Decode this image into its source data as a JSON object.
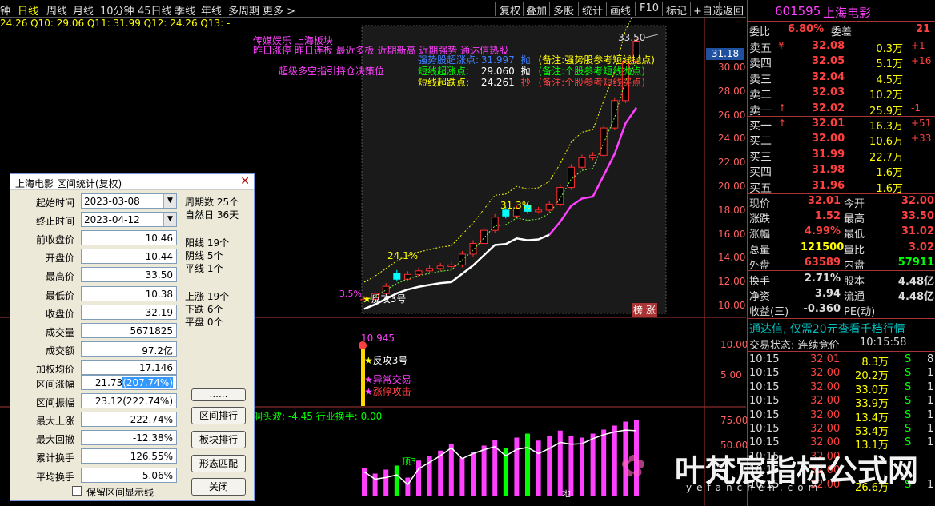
{
  "topbar": {
    "items": [
      "钟",
      "日线",
      "周线",
      "月线",
      "10分钟",
      "45日线",
      "季线",
      "年线",
      "多周期",
      "更多 >"
    ],
    "active_index": 1,
    "right_items": [
      "复权",
      "叠加",
      "多股",
      "统计",
      "画线",
      "F10",
      "标记",
      "+自选",
      "返回"
    ]
  },
  "chart": {
    "ma_line": "24.26  Q10: 29.06  Q11: 31.99  Q12: 24.26  Q13: -",
    "tags": {
      "line1": "传媒娱乐   上海板块",
      "line2": "昨日涨停 昨日连板 最近多板 近期新高 近期强势 通达信热股",
      "line3": "超级多空指引持仓决策位"
    },
    "legend": [
      {
        "name": "强势股超涨点:",
        "value": "31.997",
        "tag": "抛",
        "note": "(备注:强势股参考短线抛点)"
      },
      {
        "name": "短线超涨点:",
        "value": "29.060",
        "tag": "抛",
        "note": "(备注:个股参考短线抛点)"
      },
      {
        "name": "短线超跌点:",
        "value": "24.261",
        "tag": "抄",
        "note": "(备注:个股参考短线买点)"
      }
    ],
    "price_high_label": "33.50",
    "current_price_box": "31.18",
    "pct_labels": [
      "31.3%",
      "24.1%",
      "3.5%"
    ],
    "signal_label": "反攻3号",
    "bottom_badge": [
      "榜",
      "涨"
    ],
    "y_ticks": [
      "30.00",
      "28.00",
      "26.00",
      "24.00",
      "22.00",
      "20.00",
      "18.00",
      "16.00",
      "14.00",
      "12.00",
      "10.00"
    ],
    "sub1": {
      "value_label": "10.945",
      "signals": [
        "反攻3号",
        "异常交易",
        "涨停攻击"
      ],
      "y_ticks": [
        "10.00",
        "5.00"
      ]
    },
    "sub2": {
      "title": "洞头波: -4.45  行业换手: 0.00",
      "y_ticks": [
        "75.00",
        "50.00"
      ],
      "peak_label": "顶3",
      "low_label": "地"
    }
  },
  "chart_data": {
    "type": "bar",
    "title": "",
    "candles_close": [
      10.52,
      11.0,
      11.6,
      12.2,
      12.6,
      12.9,
      13.1,
      13.3,
      13.4,
      14.3,
      15.2,
      16.3,
      17.4,
      17.5,
      18.1,
      17.9,
      18.0,
      18.5,
      19.9,
      21.6,
      22.4,
      22.6,
      24.9,
      27.2,
      30.5,
      32.19
    ],
    "ylim": [
      10,
      33.5
    ],
    "volume_values": [
      28,
      22,
      26,
      30,
      18,
      35,
      40,
      45,
      52,
      38,
      44,
      50,
      56,
      48,
      58,
      62,
      55,
      60,
      65,
      60,
      58,
      62,
      66,
      70,
      74,
      76
    ]
  },
  "quote": {
    "code": "601595",
    "name": "上海电影",
    "ratio_label": "委比",
    "ratio_value": "6.80%",
    "diff_label": "委差",
    "diff_value": "21",
    "sells": [
      {
        "label": "卖五",
        "mark": "¥",
        "price": "32.08",
        "vol": "0.3万",
        "chg": "+1"
      },
      {
        "label": "卖四",
        "mark": "",
        "price": "32.05",
        "vol": "5.1万",
        "chg": "+16"
      },
      {
        "label": "卖三",
        "mark": "",
        "price": "32.04",
        "vol": "4.5万",
        "chg": ""
      },
      {
        "label": "卖二",
        "mark": "",
        "price": "32.03",
        "vol": "10.2万",
        "chg": ""
      },
      {
        "label": "卖一",
        "mark": "↑",
        "price": "32.02",
        "vol": "25.9万",
        "chg": "-1"
      }
    ],
    "buys": [
      {
        "label": "买一",
        "mark": "↑",
        "price": "32.01",
        "vol": "16.3万",
        "chg": "+51"
      },
      {
        "label": "买二",
        "mark": "",
        "price": "32.00",
        "vol": "10.6万",
        "chg": "+33"
      },
      {
        "label": "买三",
        "mark": "",
        "price": "31.99",
        "vol": "22.7万",
        "chg": ""
      },
      {
        "label": "买四",
        "mark": "",
        "price": "31.98",
        "vol": "1.6万",
        "chg": ""
      },
      {
        "label": "买五",
        "mark": "",
        "price": "31.96",
        "vol": "1.6万",
        "chg": ""
      }
    ],
    "stats": [
      {
        "l1": "现价",
        "v1": "32.01",
        "l2": "今开",
        "v2": "32.00"
      },
      {
        "l1": "涨跌",
        "v1": "1.52",
        "l2": "最高",
        "v2": "33.50"
      },
      {
        "l1": "涨幅",
        "v1": "4.99%",
        "l2": "最低",
        "v2": "31.02"
      },
      {
        "l1": "总量",
        "v1": "121500",
        "l2": "量比",
        "v2": "3.02"
      },
      {
        "l1": "外盘",
        "v1": "63589",
        "l2": "内盘",
        "v2": "57911"
      }
    ],
    "stats2": [
      {
        "l1": "换手",
        "v1": "2.71%",
        "l2": "股本",
        "v2": "4.48亿"
      },
      {
        "l1": "净资",
        "v1": "3.94",
        "l2": "流通",
        "v2": "4.48亿"
      },
      {
        "l1": "收益(三)",
        "v1": "-0.360",
        "l2": "PE(动)",
        "v2": ""
      }
    ],
    "banner": "通达信, 仅需20元查看千档行情",
    "trade_status_label": "交易状态: 连续竞价",
    "trade_time": "10:15:58",
    "ticks": [
      {
        "t": "10:15",
        "p": "32.01",
        "v": "8.3万",
        "s": "S",
        "n": "8"
      },
      {
        "t": "10:15",
        "p": "32.00",
        "v": "20.2万",
        "s": "S",
        "n": "1"
      },
      {
        "t": "10:15",
        "p": "32.00",
        "v": "33.0万",
        "s": "S",
        "n": "1"
      },
      {
        "t": "10:15",
        "p": "32.00",
        "v": "33.9万",
        "s": "S",
        "n": "1"
      },
      {
        "t": "10:15",
        "p": "32.00",
        "v": "13.4万",
        "s": "S",
        "n": "1"
      },
      {
        "t": "10:15",
        "p": "32.00",
        "v": "53.4万",
        "s": "S",
        "n": "1"
      },
      {
        "t": "10:15",
        "p": "32.00",
        "v": "13.1万",
        "s": "S",
        "n": "1"
      },
      {
        "t": "10:15",
        "p": "32.00",
        "v": "",
        "s": "",
        "n": ""
      },
      {
        "t": "10:15",
        "p": "32.00",
        "v": "",
        "s": "",
        "n": ""
      },
      {
        "t": "10:15",
        "p": "32.00",
        "v": "26.6万",
        "s": "S",
        "n": "1"
      }
    ]
  },
  "watermark": {
    "text": "叶梵宸指标公式网",
    "url": "yefanchen.com"
  },
  "dialog": {
    "title": "上海电影 区间统计(复权)",
    "start_label": "起始时间",
    "start_value": "2023-03-08",
    "end_label": "终止时间",
    "end_value": "2023-04-12",
    "fields": [
      {
        "label": "前收盘价",
        "value": "10.46"
      },
      {
        "label": "开盘价",
        "value": "10.44"
      },
      {
        "label": "最高价",
        "value": "33.50"
      },
      {
        "label": "最低价",
        "value": "10.38"
      },
      {
        "label": "收盘价",
        "value": "32.19"
      },
      {
        "label": "成交量",
        "value": "5671825"
      },
      {
        "label": "成交额",
        "value": "97.2亿"
      },
      {
        "label": "加权均价",
        "value": "17.146"
      }
    ],
    "range_change_label": "区间涨幅",
    "range_change_value": "21.73",
    "range_change_pct": "(207.74%)",
    "range_amp_label": "区间振幅",
    "range_amp_value": "23.12(222.74%)",
    "fields2": [
      {
        "label": "最大上涨",
        "value": "222.74%"
      },
      {
        "label": "最大回撤",
        "value": "-12.38%"
      },
      {
        "label": "累计换手",
        "value": "126.55%"
      },
      {
        "label": "平均换手",
        "value": "5.06%"
      }
    ],
    "stats": [
      "周期数 25个",
      "自然日 36天",
      "阳线 19个",
      "阴线 5个",
      "平线 1个",
      "上涨 19个",
      "下跌 6个",
      "平盘 0个"
    ],
    "buttons": [
      "......",
      "区间排行",
      "板块排行",
      "形态匹配",
      "关闭"
    ],
    "checkbox_label": "保留区间显示线"
  }
}
